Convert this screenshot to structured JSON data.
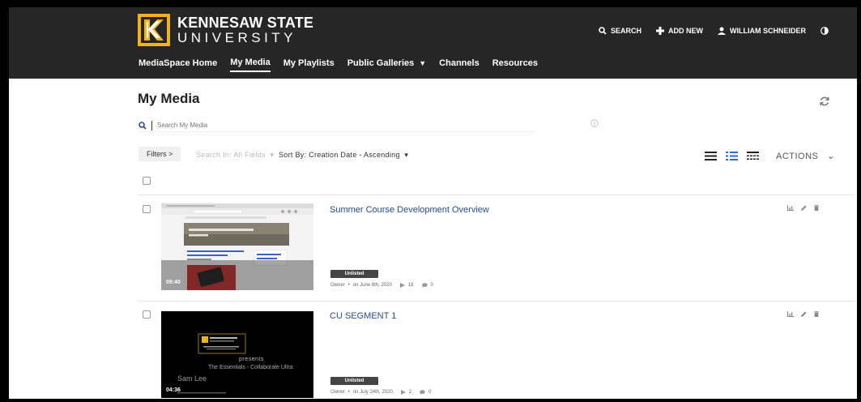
{
  "logo": {
    "line1": "KENNESAW STATE",
    "line2": "UNIVERSITY"
  },
  "nav": [
    {
      "label": "MediaSpace Home"
    },
    {
      "label": "My Media"
    },
    {
      "label": "My Playlists"
    },
    {
      "label": "Public Galleries"
    },
    {
      "label": "Channels"
    },
    {
      "label": "Resources"
    }
  ],
  "top_right": {
    "search": "SEARCH",
    "add_new": "ADD NEW",
    "user": "WILLIAM SCHNEIDER"
  },
  "page_title": "My Media",
  "search": {
    "placeholder": "Search My Media"
  },
  "toolbar": {
    "filters": "Filters  >",
    "search_in": "Search In: All Fields",
    "sort_by": "Sort By: Creation Date - Ascending",
    "actions": "ACTIONS"
  },
  "entries": [
    {
      "title": "Summer Course Development Overview",
      "duration": "09:40",
      "status": "Unlisted",
      "owner": "Owner",
      "date": "on June 8th, 2020",
      "plays": "16",
      "comments": "0"
    },
    {
      "title": "CU SEGMENT 1",
      "duration": "04:36",
      "status": "Unlisted",
      "owner": "Owner",
      "date": "on July 24th, 2020",
      "plays": "2",
      "comments": "0",
      "thumb_text": {
        "presents": "presents",
        "subtitle": "The Essentials - Collaborate Ultra",
        "presenter": "Sam Lee"
      }
    }
  ],
  "colors": {
    "header_bg": "#262626",
    "link": "#2a4b8d",
    "brand_gold": "#f2b318"
  }
}
